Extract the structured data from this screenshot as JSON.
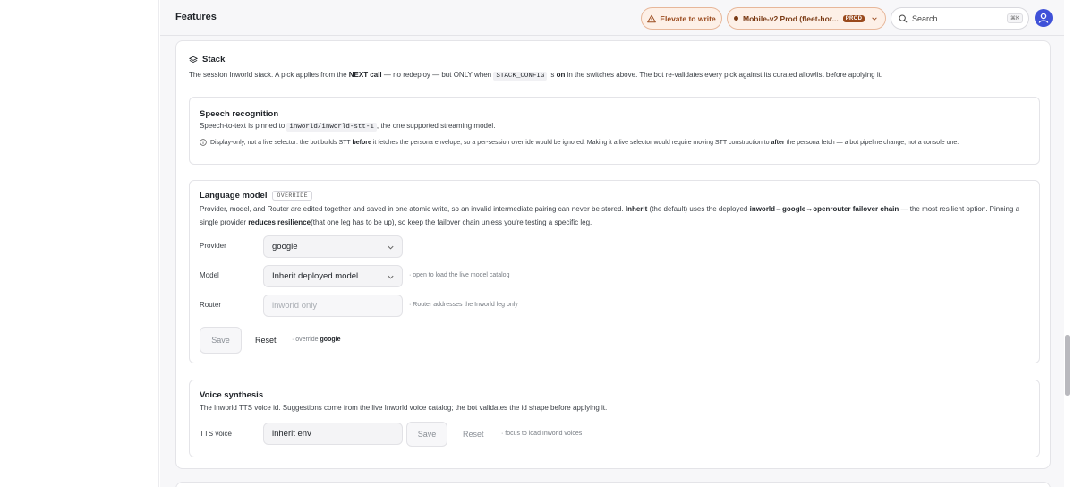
{
  "header": {
    "title": "Features",
    "elevate_label": "Elevate to write",
    "env_name": "Mobile-v2 Prod (fleet-hor...",
    "env_badge": "PROD",
    "search_placeholder": "Search",
    "search_shortcut": "⌘K",
    "colors": {
      "accent_border": "#e7b79a",
      "accent_bg": "#fdf0e7",
      "avatar": "#3f51d8"
    }
  },
  "stack": {
    "title": "Stack",
    "desc_1": "The session Inworld stack. A pick applies from the ",
    "desc_next": "NEXT call",
    "desc_2": " — no redeploy — but ONLY when ",
    "desc_code": "STACK_CONFIG",
    "desc_3": " is ",
    "desc_on": "on",
    "desc_4": " in the switches above. The bot re-validates every pick against its curated allowlist before applying it."
  },
  "speech": {
    "title": "Speech recognition",
    "desc_1": "Speech-to-text is pinned to ",
    "desc_code": "inworld/inworld-stt-1",
    "desc_2": ", the one supported streaming model.",
    "info_1": "Display-only, not a live selector: the bot builds STT ",
    "info_before": "before",
    "info_2": " it fetches the persona envelope, so a per-session override would be ignored. Making it a live selector would require moving STT construction to ",
    "info_after": "after",
    "info_3": " the persona fetch — a bot pipeline change, not a console one."
  },
  "language": {
    "title": "Language model",
    "badge": "OVERRIDE",
    "desc_1": "Provider, model, and Router are edited together and saved in one atomic write, so an invalid intermediate pairing can never be stored. ",
    "desc_inherit": "Inherit",
    "desc_2": " (the default) uses the deployed ",
    "desc_chain": "inworld→google→openrouter failover chain",
    "desc_3": " — the most resilient option. Pinning a single provider ",
    "desc_reduces": "reduces resilience",
    "desc_4": "(that one leg has to be up), so keep the failover chain unless you're testing a specific leg.",
    "provider_label": "Provider",
    "provider_value": "google",
    "model_label": "Model",
    "model_value": "Inherit deployed model",
    "model_hint": "· open to load the live model catalog",
    "router_label": "Router",
    "router_placeholder": "inworld only",
    "router_hint": "· Router addresses the Inworld leg only",
    "save_label": "Save",
    "reset_label": "Reset",
    "override_note": "· override ",
    "override_value": "google"
  },
  "voice": {
    "title": "Voice synthesis",
    "desc": "The Inworld TTS voice id. Suggestions come from the live Inworld voice catalog; the bot validates the id shape before applying it.",
    "tts_label": "TTS voice",
    "tts_placeholder": "inherit env",
    "save_label": "Save",
    "reset_label": "Reset",
    "hint": "· focus to load Inworld voices"
  }
}
